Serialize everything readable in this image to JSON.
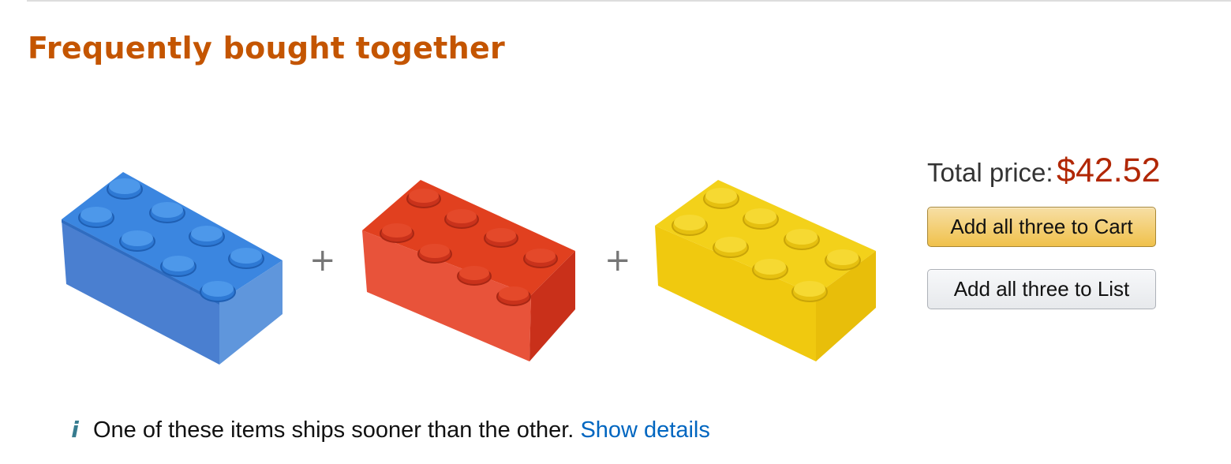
{
  "section": {
    "title": "Frequently bought together"
  },
  "products": [
    {
      "name": "blue-brick",
      "color": "#2f7fd6",
      "alt": "Blue 2x4 brick"
    },
    {
      "name": "red-brick",
      "color": "#e03a1e",
      "alt": "Red 2x4 brick"
    },
    {
      "name": "yellow-brick",
      "color": "#f2cf16",
      "alt": "Yellow 2x4 brick"
    }
  ],
  "separators": [
    "+",
    "+"
  ],
  "summary": {
    "total_label": "Total price:",
    "total_price": "$42.52",
    "add_to_cart_label": "Add all three to Cart",
    "add_to_list_label": "Add all three to List"
  },
  "notice": {
    "icon": "info-icon",
    "text": "One of these items ships sooner than the other.",
    "link_label": "Show details"
  },
  "colors": {
    "heading": "#c45500",
    "price": "#b12704",
    "link": "#0066c0",
    "cart_button": "#f0c14b",
    "list_button": "#e7e9ec"
  }
}
